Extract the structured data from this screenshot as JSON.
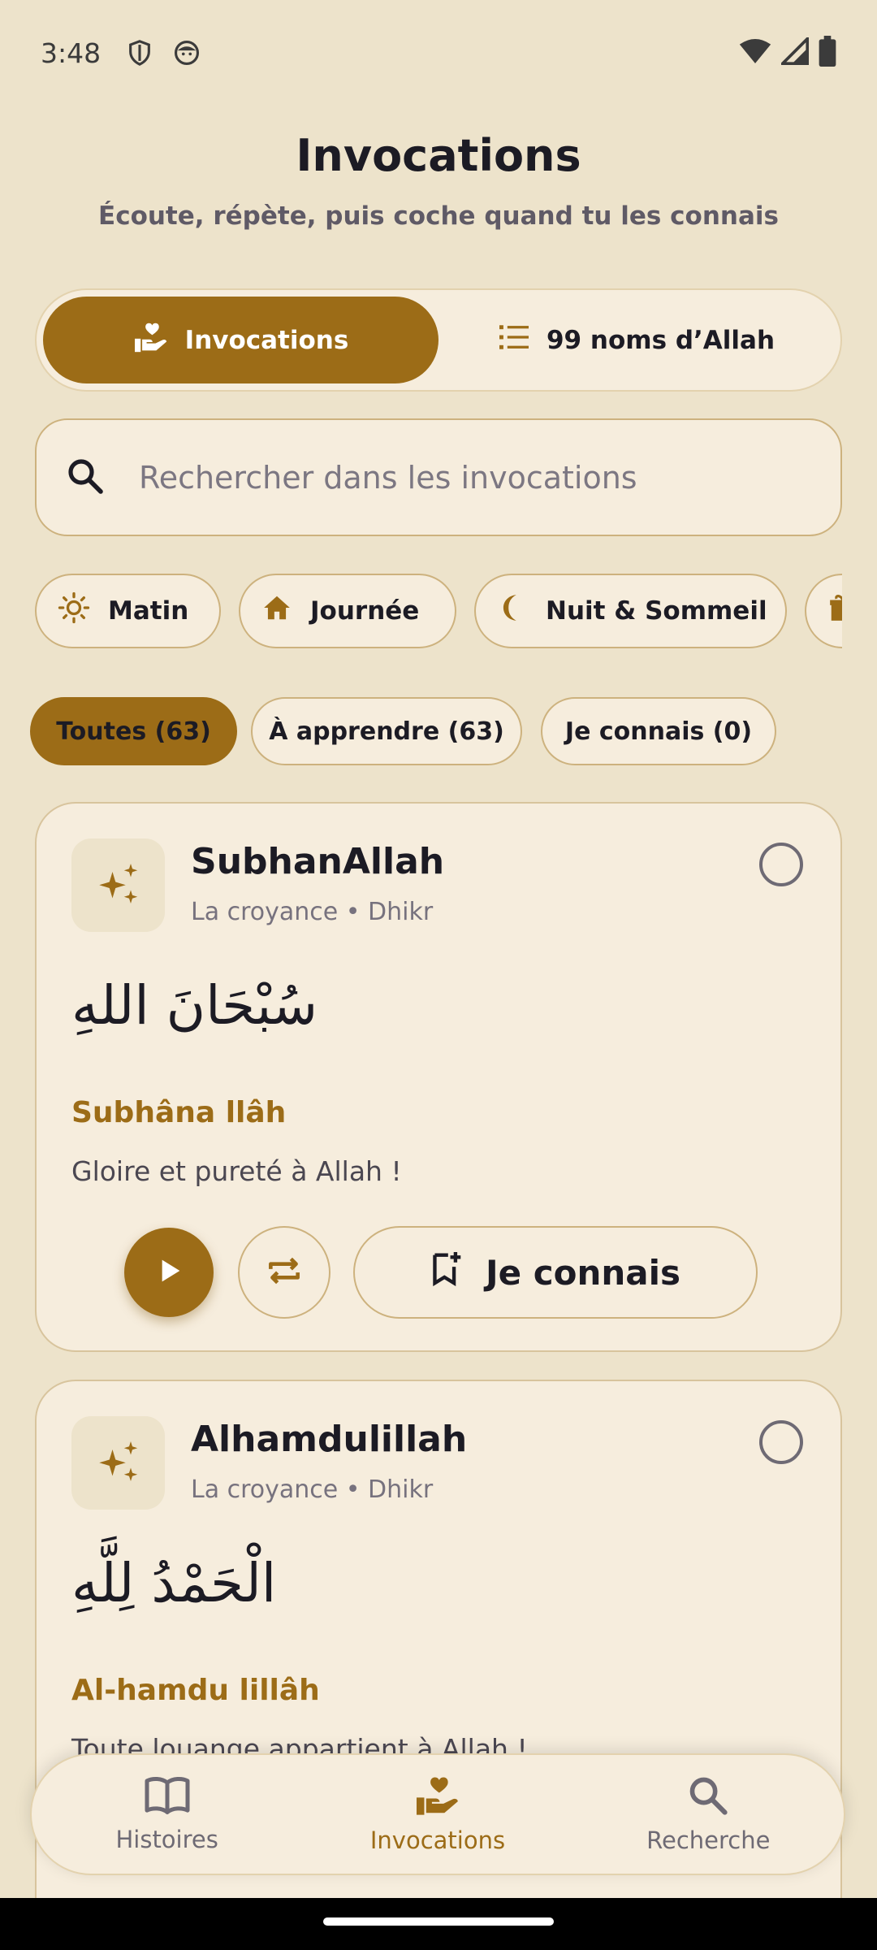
{
  "status_bar": {
    "time": "3:48"
  },
  "header": {
    "title": "Invocations",
    "subtitle": "Écoute, répète, puis coche quand tu les connais"
  },
  "segments": [
    {
      "label": "Invocations",
      "icon": "hand-heart-icon",
      "active": true
    },
    {
      "label": "99 noms d’Allah",
      "icon": "list-icon",
      "active": false
    }
  ],
  "search": {
    "placeholder": "Rechercher dans les invocations",
    "value": ""
  },
  "categories": [
    {
      "label": "Matin",
      "icon": "sun-icon"
    },
    {
      "label": "Journée",
      "icon": "home-icon"
    },
    {
      "label": "Nuit & Sommeil",
      "icon": "moon-icon"
    }
  ],
  "filter_tabs": [
    {
      "label": "Toutes (63)",
      "active": true
    },
    {
      "label": "À apprendre (63)",
      "active": false
    },
    {
      "label": "Je connais (0)",
      "active": false
    }
  ],
  "cards": [
    {
      "title": "SubhanAllah",
      "meta": "La croyance • Dhikr",
      "arabic": "سُبْحَانَ اللهِ",
      "transliteration": "Subhâna llâh",
      "translation": "Gloire et pureté à Allah !",
      "know_label": "Je connais"
    },
    {
      "title": "Alhamdulillah",
      "meta": "La croyance • Dhikr",
      "arabic": "الْحَمْدُ لِلَّهِ",
      "transliteration": "Al-hamdu lillâh",
      "translation": "Toute louange appartient à Allah !"
    }
  ],
  "bottom_nav": [
    {
      "label": "Histoires",
      "icon": "book-icon",
      "active": false
    },
    {
      "label": "Invocations",
      "icon": "hand-heart-icon",
      "active": true
    },
    {
      "label": "Recherche",
      "icon": "search-icon",
      "active": false
    }
  ],
  "colors": {
    "background": "#EDE3CB",
    "surface": "#F6EDDD",
    "accent": "#9C6C17",
    "outline": "#CDB27E"
  }
}
